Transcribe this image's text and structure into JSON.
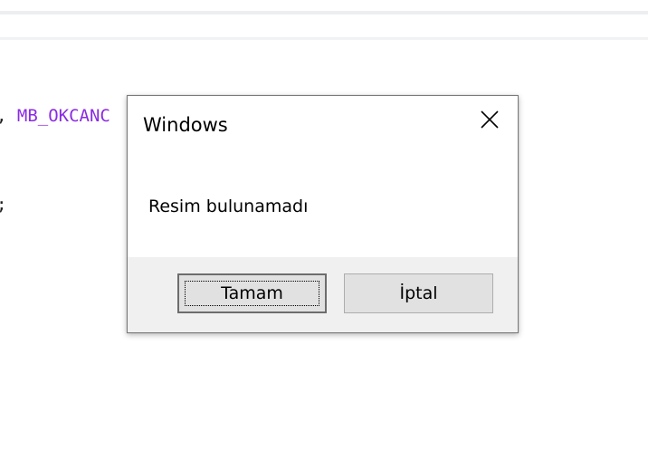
{
  "background_code": {
    "line1": {
      "comma": ",",
      "constant": "MB_OKCANC"
    },
    "line2": {
      "semicolon": ";"
    },
    "constant_color": "#8a2be2"
  },
  "dialog": {
    "title": "Windows",
    "close_icon": "close-icon",
    "message": "Resim bulunamadı",
    "buttons": {
      "ok_label": "Tamam",
      "cancel_label": "İptal"
    }
  }
}
